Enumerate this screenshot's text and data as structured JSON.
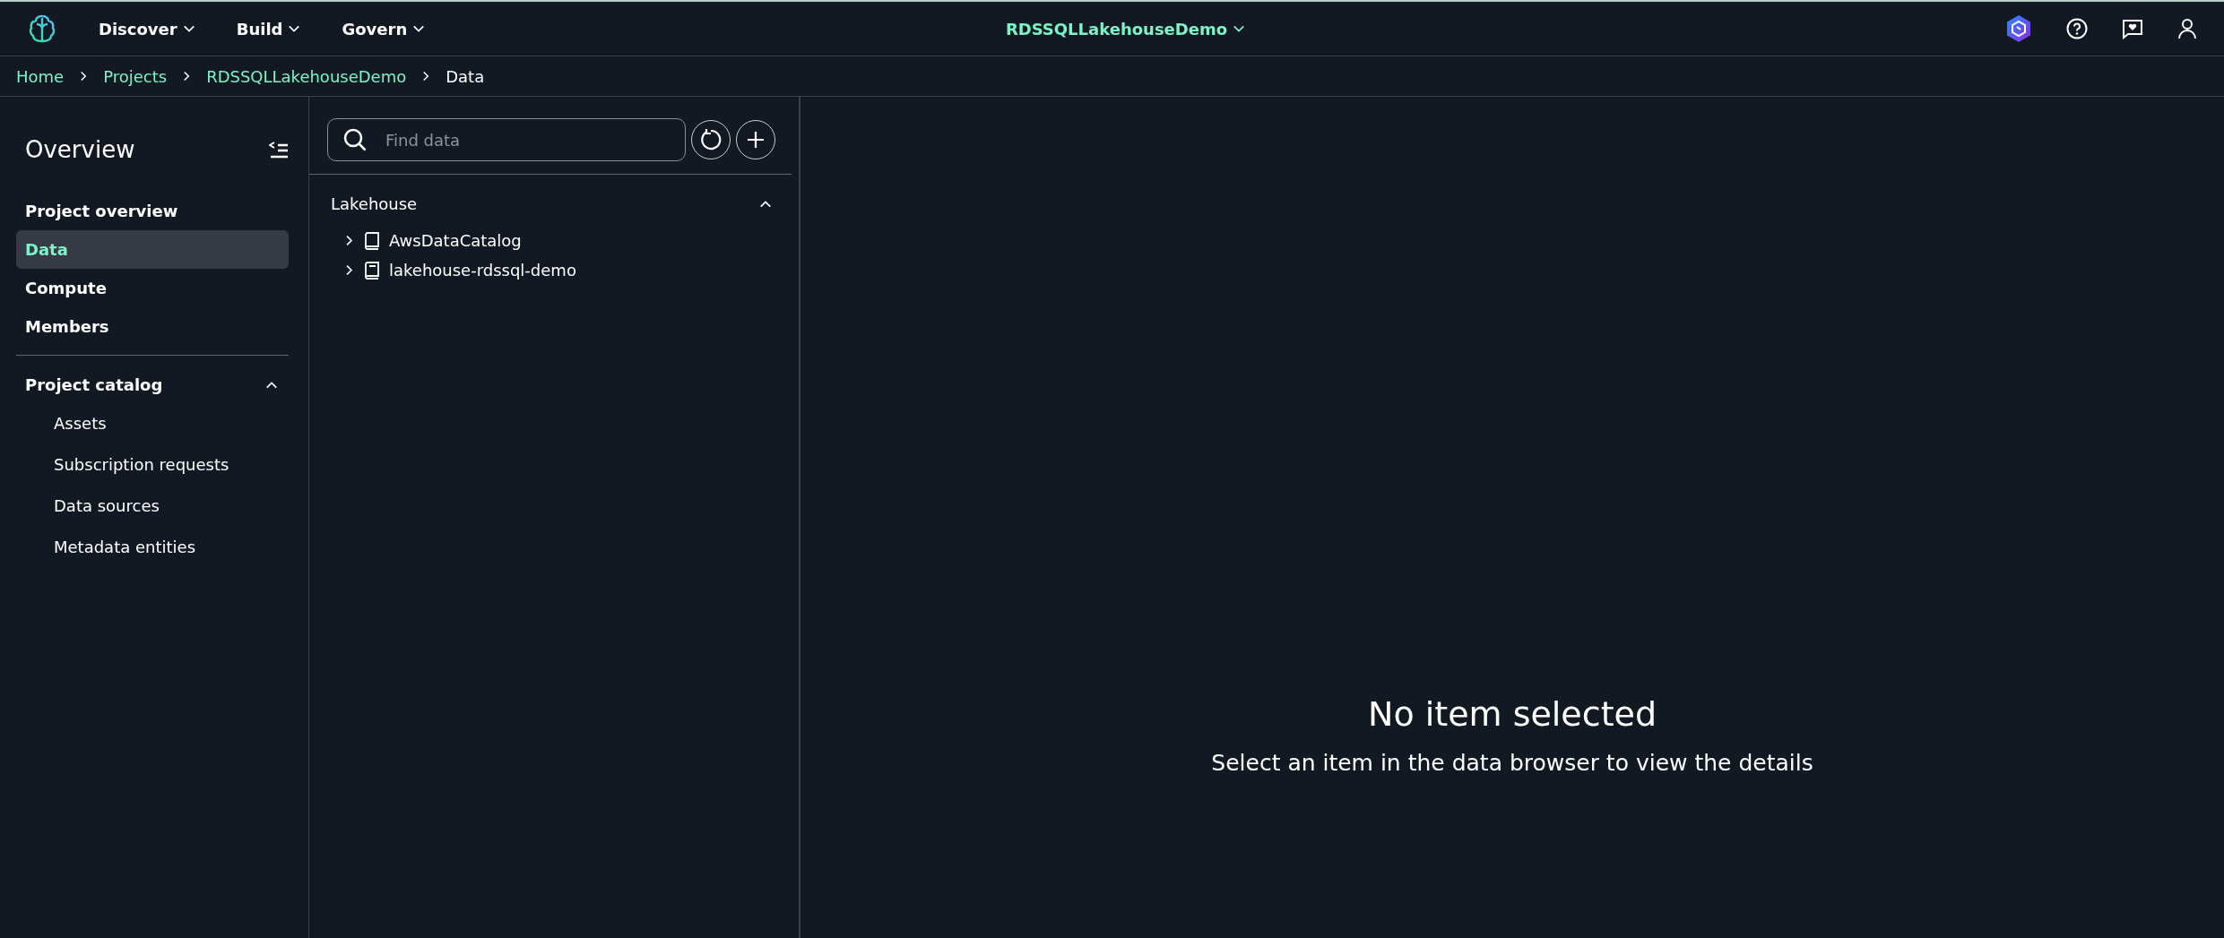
{
  "top_nav": {
    "menus": [
      {
        "label": "Discover"
      },
      {
        "label": "Build"
      },
      {
        "label": "Govern"
      }
    ],
    "project": "RDSSQLLakehouseDemo"
  },
  "breadcrumbs": [
    {
      "label": "Home",
      "link": true
    },
    {
      "label": "Projects",
      "link": true
    },
    {
      "label": "RDSSQLLakehouseDemo",
      "link": true
    },
    {
      "label": "Data",
      "link": false
    }
  ],
  "sidebar": {
    "title": "Overview",
    "items": [
      {
        "label": "Project overview",
        "selected": false
      },
      {
        "label": "Data",
        "selected": true
      },
      {
        "label": "Compute",
        "selected": false
      },
      {
        "label": "Members",
        "selected": false
      }
    ],
    "section": {
      "label": "Project catalog",
      "expanded": true,
      "items": [
        {
          "label": "Assets"
        },
        {
          "label": "Subscription requests"
        },
        {
          "label": "Data sources"
        },
        {
          "label": "Metadata entities"
        }
      ]
    }
  },
  "data_browser": {
    "search": {
      "placeholder": "Find data"
    },
    "section": {
      "label": "Lakehouse",
      "expanded": true
    },
    "tree": [
      {
        "label": "AwsDataCatalog",
        "expanded": false,
        "kind": "catalog"
      },
      {
        "label": "lakehouse-rdssql-demo",
        "expanded": false,
        "kind": "database"
      }
    ]
  },
  "details": {
    "title": "No item selected",
    "message": "Select an item in the data browser to view the details"
  }
}
